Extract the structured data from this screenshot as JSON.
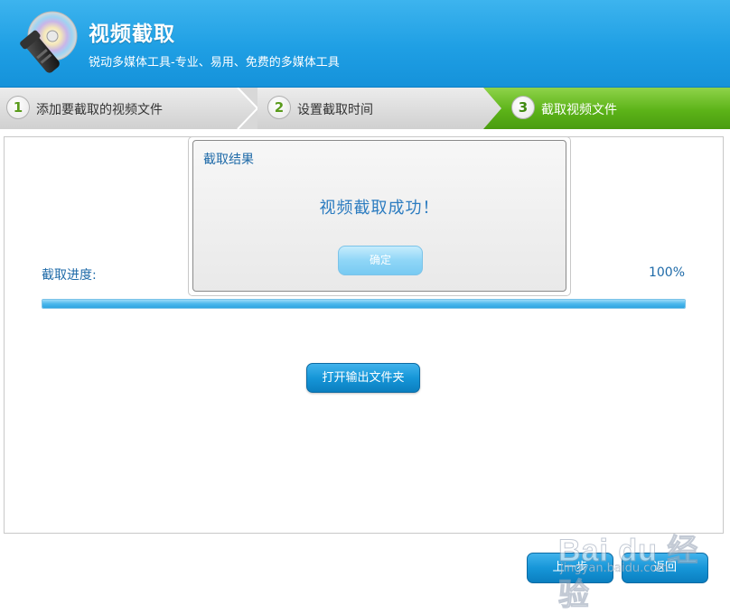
{
  "header": {
    "title": "视频截取",
    "subtitle": "锐动多媒体工具-专业、易用、免费的多媒体工具"
  },
  "steps": [
    {
      "number": "1",
      "label": "添加要截取的视频文件",
      "active": false
    },
    {
      "number": "2",
      "label": "设置截取时间",
      "active": false
    },
    {
      "number": "3",
      "label": "截取视频文件",
      "active": true
    }
  ],
  "progress": {
    "label": "截取进度:",
    "percent_text": "100%",
    "value": 1.0
  },
  "open_folder_label": "打开输出文件夹",
  "dialog": {
    "title": "截取结果",
    "message": "视频截取成功！",
    "ok_label": "确定"
  },
  "buttons": {
    "prev_label": "上一步",
    "back_label": "返回"
  },
  "watermark": {
    "brand": "Bai du 经验",
    "url": "jingyan.baidu.com"
  },
  "colors": {
    "header_blue": "#1f9fe4",
    "active_step_green": "#5cb318",
    "accent_text": "#1e6aa8"
  }
}
